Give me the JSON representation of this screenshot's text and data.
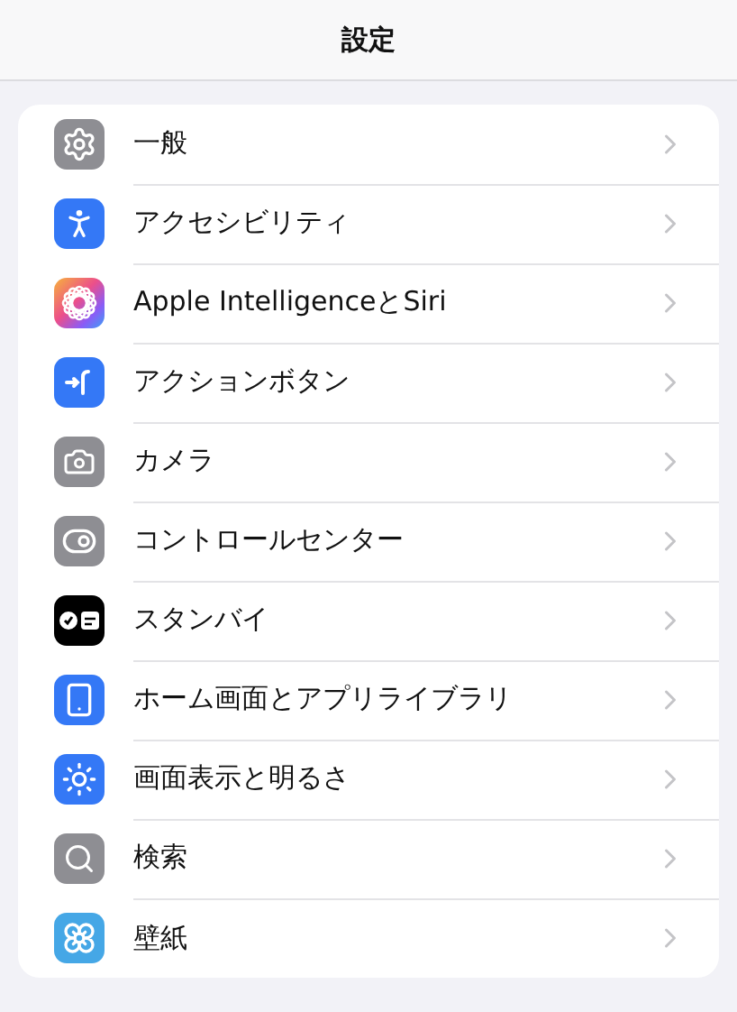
{
  "title": "設定",
  "items": [
    {
      "label": "一般"
    },
    {
      "label": "アクセシビリティ"
    },
    {
      "label": "Apple IntelligenceとSiri"
    },
    {
      "label": "アクションボタン"
    },
    {
      "label": "カメラ"
    },
    {
      "label": "コントロールセンター"
    },
    {
      "label": "スタンバイ"
    },
    {
      "label": "ホーム画面とアプリライブラリ"
    },
    {
      "label": "画面表示と明るさ"
    },
    {
      "label": "検索"
    },
    {
      "label": "壁紙"
    }
  ]
}
